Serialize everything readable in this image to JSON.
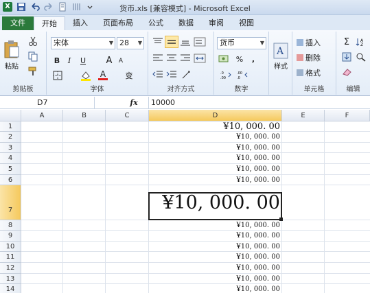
{
  "window": {
    "title": "货币.xls [兼容模式] - Microsoft Excel"
  },
  "tabs": [
    "文件",
    "开始",
    "插入",
    "页面布局",
    "公式",
    "数据",
    "审阅",
    "视图"
  ],
  "ribbon": {
    "clipboard": {
      "paste": "粘贴",
      "label": "剪贴板"
    },
    "font": {
      "name": "宋体",
      "size": "28",
      "label": "字体",
      "bold": "B",
      "italic": "I",
      "underline": "U",
      "grow": "A",
      "shrink": "A",
      "color_letter": "A",
      "wen": "变"
    },
    "alignment": {
      "label": "对齐方式"
    },
    "number": {
      "format": "货币",
      "label": "数字",
      "percent": "%",
      "comma": ","
    },
    "styles": {
      "label": "样式"
    },
    "cells": {
      "insert": "插入",
      "delete": "删除",
      "format": "格式",
      "label": "单元格"
    },
    "editing": {
      "sigma": "Σ",
      "label": "编辑"
    }
  },
  "formula_bar": {
    "name_box": "D7",
    "fx": "fx",
    "value": "10000"
  },
  "columns": [
    "A",
    "B",
    "C",
    "D",
    "E",
    "F"
  ],
  "rows": [
    "1",
    "2",
    "3",
    "4",
    "5",
    "6",
    "7",
    "8",
    "9",
    "10",
    "11",
    "12",
    "13",
    "14"
  ],
  "cells": [
    "¥10, 000. 00",
    "¥10, 000. 00",
    "¥10, 000. 00",
    "¥10, 000. 00",
    "¥10, 000. 00",
    "¥10, 000. 00",
    "¥10, 000. 00",
    "¥10, 000. 00",
    "¥10, 000. 00",
    "¥10, 000. 00",
    "¥10, 000. 00",
    "¥10, 000. 00",
    "¥10, 000. 00",
    "¥10, 000. 00"
  ],
  "colors": {
    "file_tab": "#2b7a3b",
    "selection_header": "#f5c95d"
  }
}
